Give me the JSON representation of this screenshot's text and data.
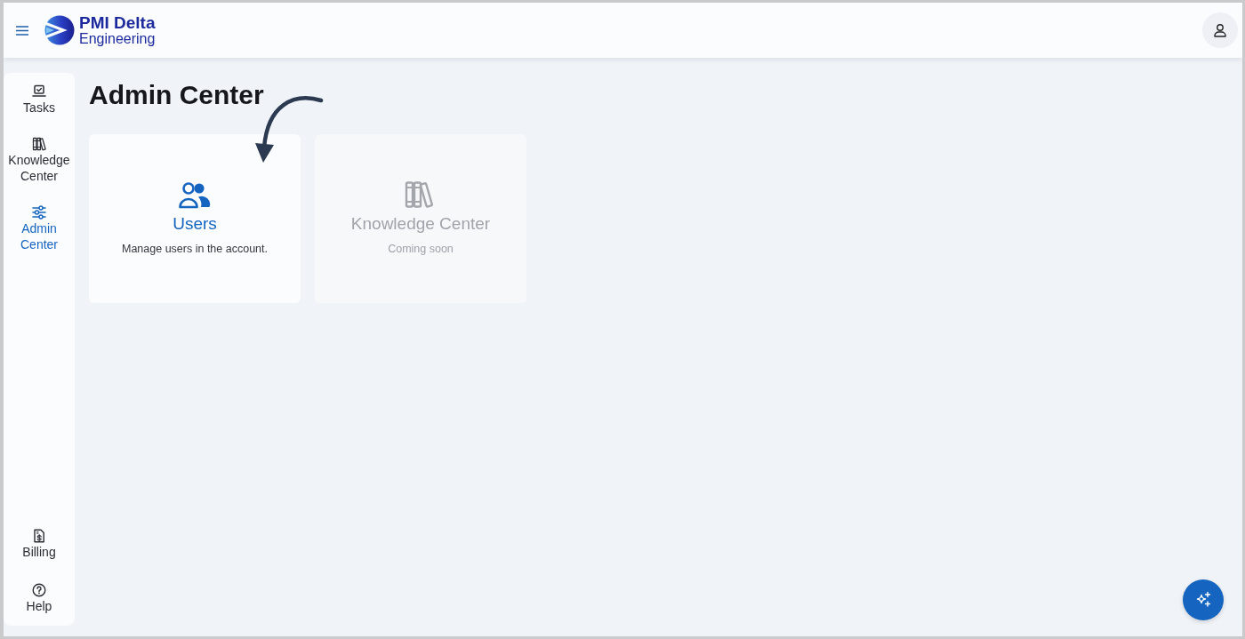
{
  "header": {
    "logo": {
      "title": "PMI Delta",
      "subtitle": "Engineering"
    }
  },
  "sidebar": {
    "items": [
      {
        "label": "Tasks",
        "selected": false
      },
      {
        "label": "Knowledge Center",
        "selected": false
      },
      {
        "label": "Admin Center",
        "selected": true
      }
    ],
    "bottom_items": [
      {
        "label": "Billing",
        "selected": false
      },
      {
        "label": "Help",
        "selected": false
      }
    ]
  },
  "page": {
    "title": "Admin Center"
  },
  "cards": [
    {
      "title": "Users",
      "description": "Manage users in the account.",
      "disabled": false
    },
    {
      "title": "Knowledge Center",
      "description": "Coming soon",
      "disabled": true
    }
  ]
}
